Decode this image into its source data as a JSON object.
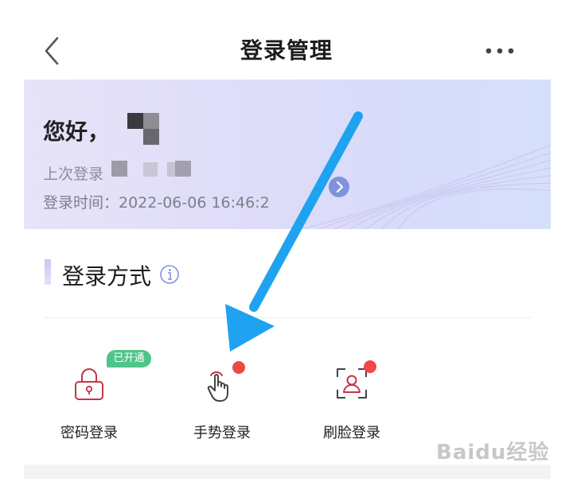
{
  "header": {
    "title": "登录管理",
    "back_icon": "chevron-left-icon",
    "more_icon": "more-dots-icon"
  },
  "banner": {
    "greeting": "您好，",
    "last_login_label": "上次登录",
    "login_time": "登录时间：2022-06-06 16:46:2",
    "arrow_icon": "chevron-right-icon"
  },
  "section": {
    "title": "登录方式",
    "info_icon": "info-icon"
  },
  "methods": [
    {
      "label": "密码登录",
      "icon": "lock-icon",
      "badge": "已开通"
    },
    {
      "label": "手势登录",
      "icon": "hand-gesture-icon"
    },
    {
      "label": "刷脸登录",
      "icon": "face-scan-icon"
    }
  ],
  "watermark": "Baidu经验",
  "colors": {
    "accent": "#7f92dc",
    "badge": "#4ec58a",
    "dot": "#f04848",
    "icon": "#c4354a",
    "arrow": "#1fa3f0"
  }
}
